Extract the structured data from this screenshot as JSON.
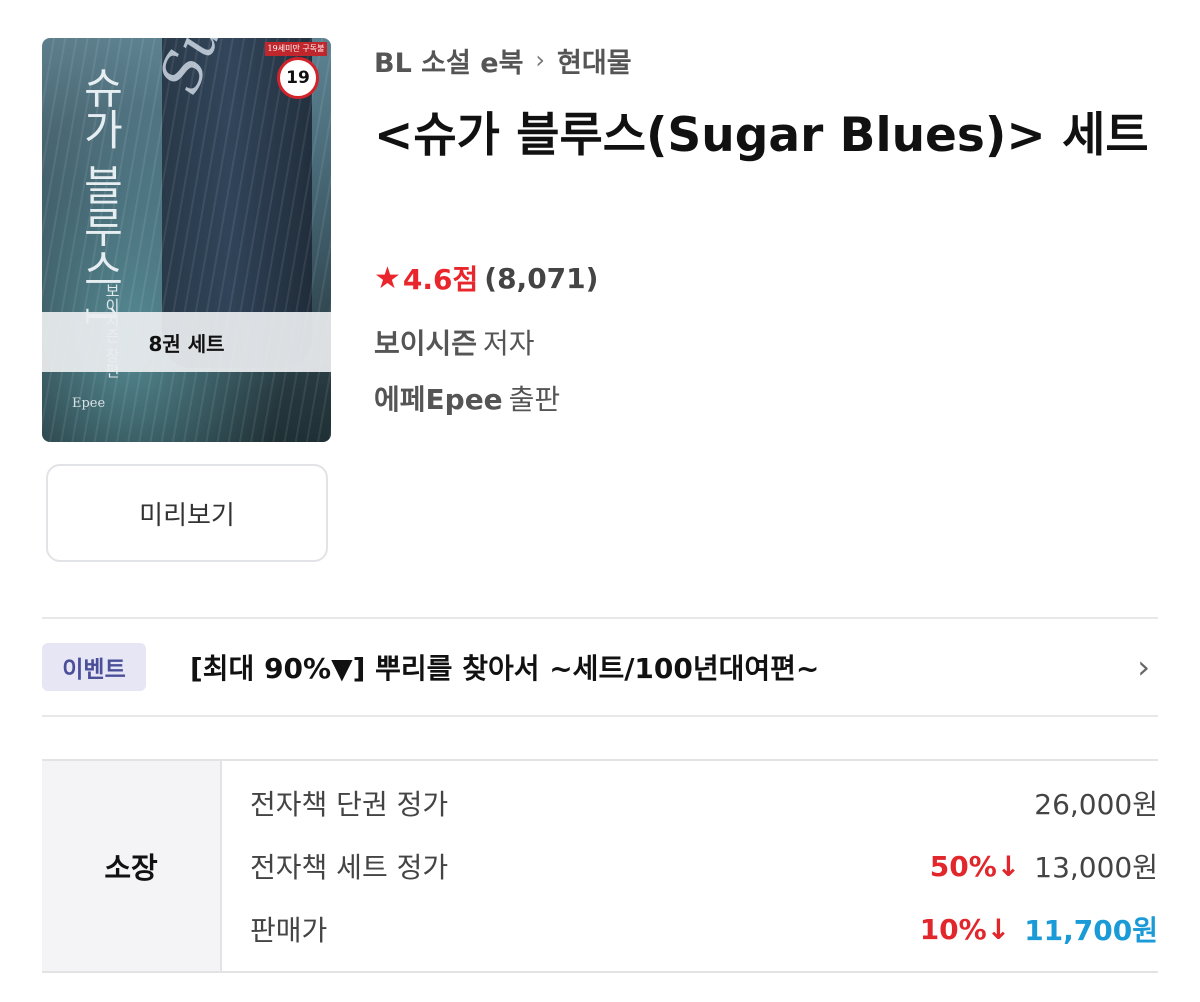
{
  "cover": {
    "age_tag": "19세미만 구독불가",
    "age_badge": "19",
    "vertical_title": "슈가 블루스 1",
    "vertical_author": "보이시즌 장편",
    "script_title": "Sugar Blues",
    "set_label": "8권 세트",
    "publisher_mark": "Epee"
  },
  "preview_button": "미리보기",
  "breadcrumb": {
    "category": "BL 소설 e북",
    "separator": "›",
    "subcategory": "현대물"
  },
  "title": "<슈가 블루스(Sugar Blues)> 세트",
  "rating": {
    "star": "★",
    "score": "4.6점",
    "count": "(8,071)"
  },
  "author": {
    "name": "보이시즌",
    "role": "저자"
  },
  "publisher": {
    "name": "에페Epee",
    "role": "출판"
  },
  "event": {
    "tag": "이벤트",
    "text": "[최대 90%▼] 뿌리를 찾아서 ~세트/100년대여편~",
    "chevron": "›"
  },
  "price": {
    "section": "소장",
    "rows": [
      {
        "label": "전자책 단권 정가",
        "discount": "",
        "amount": "26,000원"
      },
      {
        "label": "전자책 세트 정가",
        "discount": "50%↓",
        "amount": "13,000원"
      },
      {
        "label": "판매가",
        "discount": "10%↓",
        "amount": "11,700원"
      }
    ]
  },
  "colors": {
    "accent_red": "#e8262b",
    "sale_blue": "#1a9ad6",
    "event_tag_bg": "#e6e6f4"
  }
}
